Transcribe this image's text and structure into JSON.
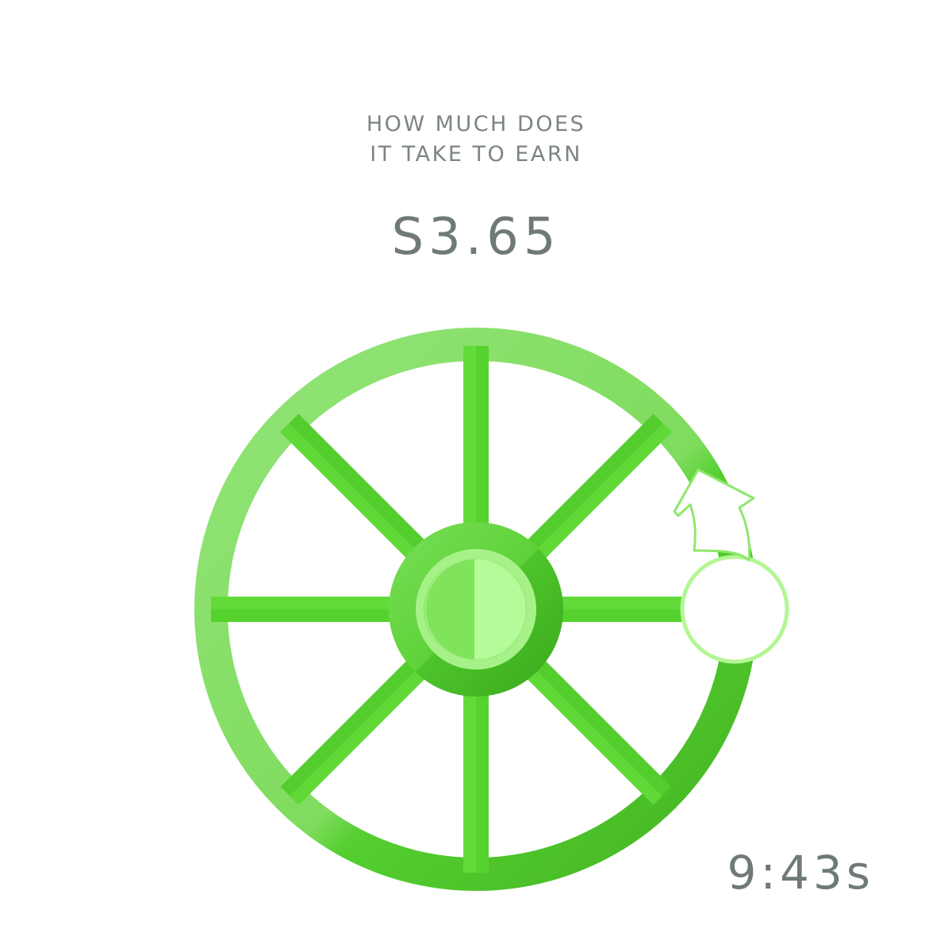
{
  "prompt": {
    "line1": "HOW MUCH DOES",
    "line2": "IT TAKE TO EARN"
  },
  "amount": "S3.65",
  "timer": "9:43s",
  "colors": {
    "text": "#7b8582",
    "rim_light": "#8fe070",
    "rim_dark": "#4cc42a",
    "spoke": "#5ad632",
    "hub_outer": "#4fc92d",
    "hub_inner": "#b4fc98",
    "handle_stroke": "#b7f99a",
    "arrow_stroke": "#7fe860"
  },
  "icons": {
    "wheel": "wheel-icon",
    "rotate_arrow": "rotate-arrow-icon",
    "handle": "crank-handle-icon"
  }
}
